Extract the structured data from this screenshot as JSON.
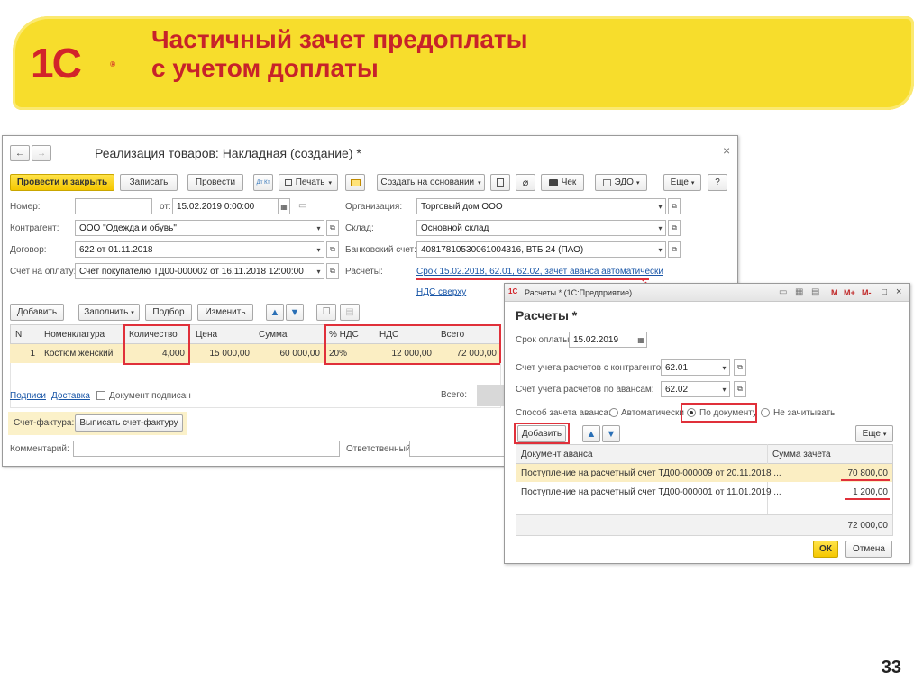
{
  "slide": {
    "title_line1": "Частичный зачет предоплаты",
    "title_line2": "с учетом доплаты",
    "logo_text": "1С",
    "logo_mark": "®",
    "page_number": "33"
  },
  "colors": {
    "accent": "#c7222a",
    "banner": "#f7dd2c",
    "primary_button": "#f5c700",
    "link": "#1a57a8",
    "highlight": "#e0303a"
  },
  "doc": {
    "title": "Реализация товаров: Накладная (создание) *",
    "nav": {
      "back": "←",
      "forward": "→",
      "close": "×"
    },
    "toolbar": {
      "post_close": "Провести и закрыть",
      "save": "Записать",
      "post": "Провести",
      "dtkt": "Дт Кт",
      "print": "Печать",
      "create_based": "Создать на основании",
      "receipt": "Чек",
      "edo": "ЭДО",
      "more": "Еще",
      "help": "?"
    },
    "fields": {
      "number_label": "Номер:",
      "number_value": "",
      "from_label": "от:",
      "date_value": "15.02.2019  0:00:00",
      "org_label": "Организация:",
      "org_value": "Торговый дом ООО",
      "contractor_label": "Контрагент:",
      "contractor_value": "ООО \"Одежда и обувь\"",
      "warehouse_label": "Склад:",
      "warehouse_value": "Основной склад",
      "contract_label": "Договор:",
      "contract_value": "622 от 01.11.2018",
      "bank_label": "Банковский счет:",
      "bank_value": "40817810530061004316, ВТБ 24 (ПАО)",
      "invoice_label": "Счет на оплату:",
      "invoice_value": "Счет покупателю ТД00-000002 от 16.11.2018 12:00:00",
      "settlements_label": "Расчеты:",
      "settlements_link": "Срок 15.02.2018, 62.01, 62.02, зачет аванса автоматически",
      "vat_link": "НДС сверху"
    },
    "table_toolbar": {
      "add": "Добавить",
      "fill": "Заполнить",
      "select": "Подбор",
      "change": "Изменить"
    },
    "table": {
      "columns": [
        "N",
        "Номенклатура",
        "Количество",
        "Цена",
        "Сумма",
        "% НДС",
        "НДС",
        "Всего"
      ],
      "rows": [
        [
          "1",
          "Костюм женский",
          "4,000",
          "15 000,00",
          "60 000,00",
          "20%",
          "12 000,00",
          "72 000,00"
        ]
      ]
    },
    "footer": {
      "signatures": "Подписи",
      "delivery": "Доставка",
      "signed_label": "Документ подписан",
      "total_label": "Всего:",
      "invoice_label": "Счет-фактура:",
      "invoice_button": "Выписать счет-фактуру",
      "comment_label": "Комментарий:",
      "responsible_label": "Ответственный:"
    }
  },
  "dialog": {
    "window_title": "Расчеты * (1С:Предприятие)",
    "title_icon": "1С",
    "controls": [
      "M",
      "M+",
      "M-",
      "□",
      "×"
    ],
    "heading": "Расчеты *",
    "due_label": "Срок оплаты:",
    "due_value": "15.02.2019",
    "acc_contractor_label": "Счет учета расчетов с контрагентом:",
    "acc_contractor_value": "62.01",
    "acc_advance_label": "Счет учета расчетов по авансам:",
    "acc_advance_value": "62.02",
    "offset_label": "Способ зачета аванса:",
    "options": [
      "Автоматически",
      "По документу",
      "Не зачитывать"
    ],
    "selected_option": "По документу",
    "add_button": "Добавить",
    "more_button": "Еще",
    "columns": [
      "Документ аванса",
      "Сумма зачета"
    ],
    "rows": [
      [
        "Поступление на расчетный счет ТД00-000009 от 20.11.2018 ...",
        "70 800,00"
      ],
      [
        "Поступление на расчетный счет ТД00-000001 от 11.01.2019 ...",
        "1 200,00"
      ]
    ],
    "total": "72 000,00",
    "ok": "ОК",
    "cancel": "Отмена"
  }
}
